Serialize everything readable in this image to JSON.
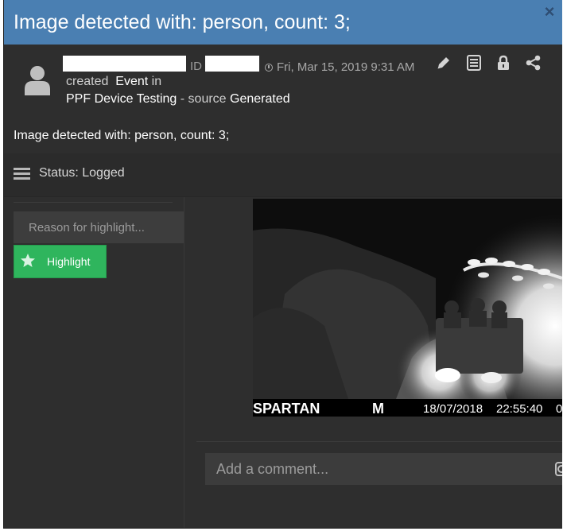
{
  "modal": {
    "title": "Image detected with: person, count: 3;",
    "close_label": "×"
  },
  "header": {
    "id_label": "ID",
    "timestamp": "Fri, Mar 15, 2019 9:31 AM",
    "action_verb": "created",
    "event_type": "Event",
    "preposition": "in",
    "project": "PPF Device Testing",
    "source_sep": "- source",
    "source": "Generated",
    "tools": [
      "pencil-icon",
      "document-icon",
      "lock-icon",
      "share-icon"
    ]
  },
  "event": {
    "description": "Image detected with: person, count: 3;"
  },
  "status": {
    "label": "Status: Logged"
  },
  "highlight": {
    "reason_placeholder": "Reason for highlight...",
    "button_label": "Highlight",
    "button_color": "#2fb55d"
  },
  "image": {
    "camera_name": "SPARTAN",
    "mode": "M",
    "date": "18/07/2018",
    "time": "22:55:40",
    "extra": "0"
  },
  "comment": {
    "placeholder": "Add a comment..."
  },
  "colors": {
    "title_bar": "#4a7fb2",
    "modal_bg": "#2e2e2e"
  }
}
